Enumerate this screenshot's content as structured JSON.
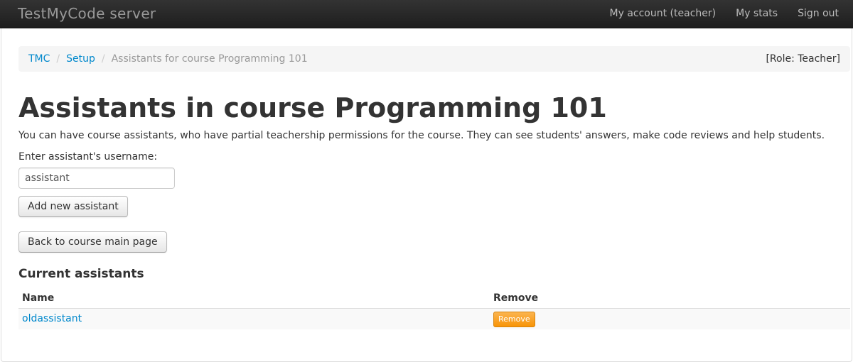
{
  "navbar": {
    "brand": "TestMyCode server",
    "links": [
      "My account (teacher)",
      "My stats",
      "Sign out"
    ]
  },
  "breadcrumb": {
    "items": [
      "TMC",
      "Setup"
    ],
    "divider": "/",
    "active": "Assistants for course Programming 101",
    "role": "[Role: Teacher]"
  },
  "page": {
    "title": "Assistants in course Programming 101",
    "intro": "You can have course assistants, who have partial teachership permissions for the course. They can see students' answers, make code reviews and help students.",
    "username_label": "Enter assistant's username:",
    "username_value": "assistant",
    "add_button": "Add new assistant",
    "back_button": "Back to course main page"
  },
  "assistants": {
    "heading": "Current assistants",
    "columns": [
      "Name",
      "Remove"
    ],
    "rows": [
      {
        "name": "oldassistant",
        "action": "Remove"
      }
    ]
  },
  "colors": {
    "link": "#0088cc",
    "navbar": "#1b1b1b",
    "remove_button": "#f89406"
  }
}
